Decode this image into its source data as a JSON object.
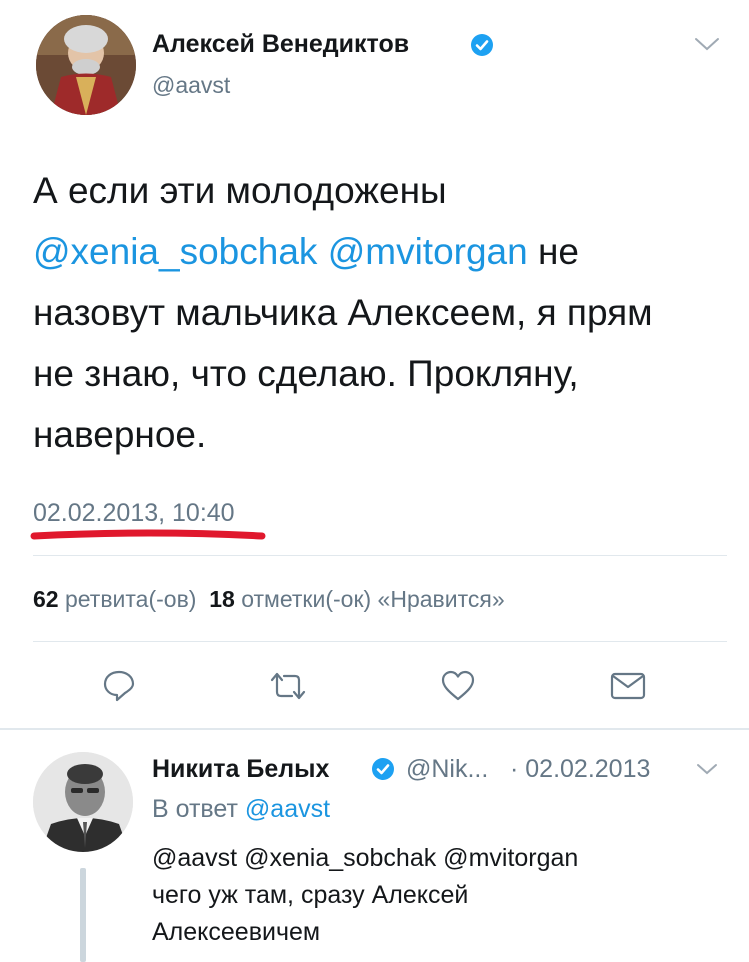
{
  "tweet": {
    "author_name": "Алексей Венедиктов",
    "handle": "@aavst",
    "text_line1": "А если эти молодожены",
    "mention1": "@xenia_sobchak",
    "mention2": "@mvitorgan",
    "text_line2_rest": " не",
    "text_line3": "назовут мальчика Алексеем, я прям",
    "text_line4": "не знаю, что сделаю. Прокляну,",
    "text_line5": "наверное.",
    "timestamp": "02.02.2013, 10:40",
    "retweets_count": "62",
    "retweets_label": "ретвита(-ов)",
    "likes_count": "18",
    "likes_label": "отметки(-ок) «Нравится»"
  },
  "reply": {
    "author_name": "Никита Белых",
    "handle": "@Nik...",
    "date": "· 02.02.2013",
    "in_reply_label": "В ответ",
    "in_reply_handle": "@aavst",
    "mentions": "@aavst @xenia_sobchak @mvitorgan",
    "text_line1": "чего уж там, сразу Алексей",
    "text_line2": "Алексеевичем"
  },
  "colors": {
    "link": "#1b95e0",
    "secondary": "#657786",
    "verified": "#1da1f2",
    "underline_annotation": "#e0182d"
  },
  "icons": [
    "chevron-down-icon",
    "verified-icon",
    "reply-icon",
    "retweet-icon",
    "like-icon",
    "dm-icon"
  ]
}
